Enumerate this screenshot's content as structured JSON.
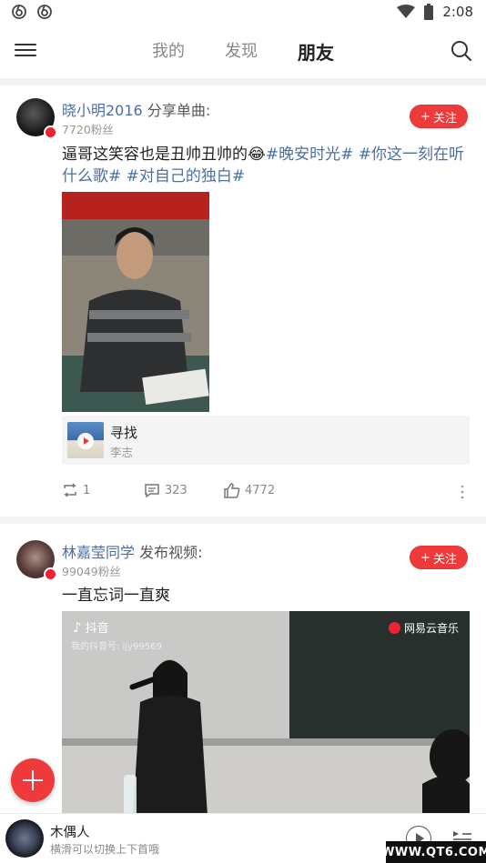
{
  "status_bar": {
    "time": "2:08"
  },
  "nav": {
    "tabs": [
      {
        "label": "我的"
      },
      {
        "label": "发现"
      },
      {
        "label": "朋友"
      }
    ]
  },
  "posts": [
    {
      "user": "晓小明2016",
      "action": "分享单曲:",
      "fans": "7720粉丝",
      "follow_label": "关注",
      "text_main": "逼哥这笑容也是丑帅丑帅的",
      "emoji": "😂",
      "hashtags": [
        "#晚安时光#",
        "#你这一刻在听什么歌#",
        "#对自己的独白#"
      ],
      "song": {
        "title": "寻找",
        "artist": "李志"
      },
      "stats": {
        "reposts": "1",
        "comments": "323",
        "likes": "4772"
      }
    },
    {
      "user": "林嘉莹同学",
      "action": "发布视频:",
      "fans": "99049粉丝",
      "follow_label": "关注",
      "text_main": "一直忘词一直爽",
      "video": {
        "app_label": "抖音",
        "account": "我的抖音号: ljy99569",
        "brand": "网易云音乐"
      }
    }
  ],
  "mini_player": {
    "title": "木偶人",
    "subtitle": "横滑可以切换上下首哦"
  },
  "watermark": "WWW.QT6.COM",
  "colors": {
    "accent": "#ee3a3a",
    "link": "#4a6fa5"
  }
}
